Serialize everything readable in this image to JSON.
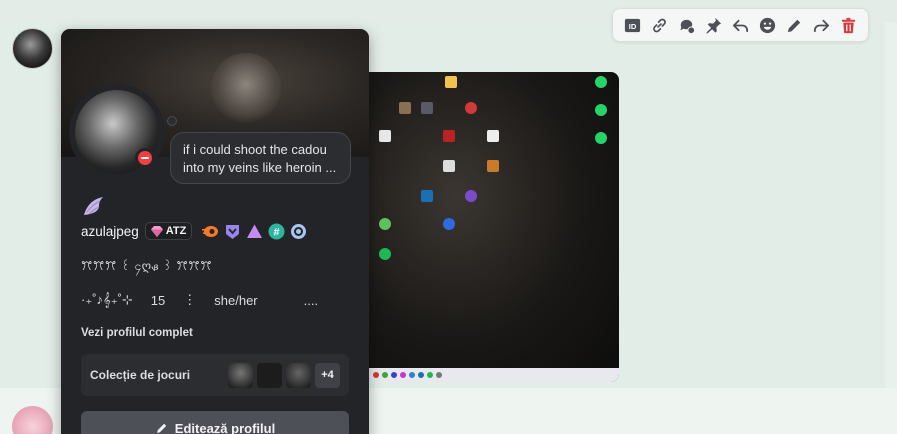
{
  "toolbar": {
    "buttons": [
      {
        "name": "copy-id-icon",
        "color": "#4e5058"
      },
      {
        "name": "copy-link-icon",
        "color": "#4e5058"
      },
      {
        "name": "create-thread-icon",
        "color": "#4e5058"
      },
      {
        "name": "pin-icon",
        "color": "#4e5058"
      },
      {
        "name": "reply-icon",
        "color": "#4e5058"
      },
      {
        "name": "add-reaction-icon",
        "color": "#4e5058"
      },
      {
        "name": "edit-icon",
        "color": "#4e5058"
      },
      {
        "name": "forward-icon",
        "color": "#4e5058"
      },
      {
        "name": "delete-icon",
        "color": "#da373c"
      }
    ]
  },
  "profile": {
    "status_text": "if i could shoot the cadou into my veins like heroin ...",
    "status": "do-not-disturb",
    "username": "azulajpeg",
    "guild_tag": "ATZ",
    "pronoun_deco": "ꔫꔫꔫ ꒰ ၄ღᏸ ꒱ ꔫꔫꔫ",
    "info_symbols": "·₊˚♪𝄞₊˚⊹",
    "info_number": "15",
    "info_sep": "⋮",
    "pronouns": "she/her",
    "info_trail": "....",
    "view_full_profile": "Vezi profilul complet",
    "game_collection": "Colecție de jocuri",
    "game_more": "+4",
    "edit_profile": "Editează profilul"
  },
  "colors": {
    "popout_bg": "#232428",
    "dnd_red": "#f23f43",
    "chat_bg": "#e3ede8"
  }
}
